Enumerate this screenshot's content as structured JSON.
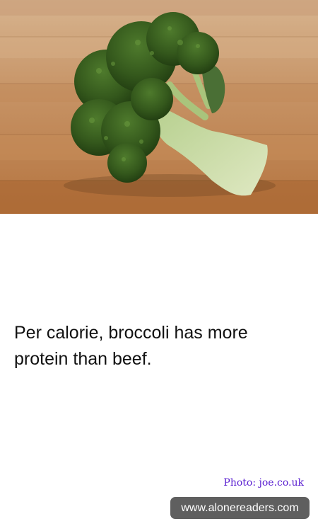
{
  "photo": {
    "subject": "broccoli on wooden table",
    "icon": "broccoli-photo"
  },
  "fact": {
    "text": "Per calorie, broccoli has more protein than beef."
  },
  "credit": {
    "text": "Photo: joe.co.uk"
  },
  "site": {
    "text": "www.alonereaders.com"
  },
  "colors": {
    "credit": "#5a1fd1",
    "badge": "#5f5f5f",
    "text": "#111111"
  }
}
